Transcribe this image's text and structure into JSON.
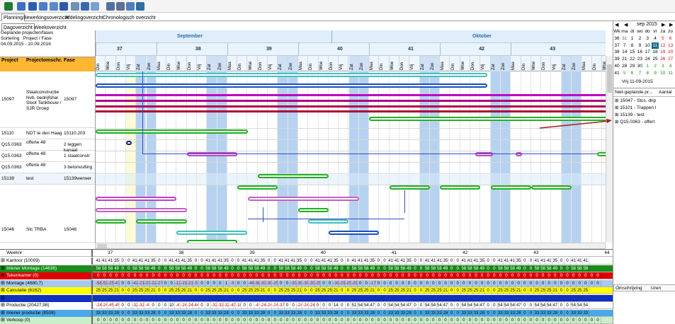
{
  "tabs": [
    "Planning",
    "Bewerkingsoverzicht",
    "Afdelingoverzicht",
    "Chronologisch overzicht"
  ],
  "subtabs": [
    "Dagoverzicht",
    "Weekoverzicht"
  ],
  "info": {
    "line1": "Geplande projecten/fases",
    "line2": "Sortering : Project / Fase",
    "line3": "04.09.2015 - 10.09.2016"
  },
  "columns": {
    "project": "Project",
    "omschr": "Projectomschr.",
    "fase": "Fase"
  },
  "months": [
    {
      "label": "September"
    },
    {
      "label": "Oktober"
    }
  ],
  "weeks": [
    "37",
    "38",
    "39",
    "40",
    "41",
    "42",
    "43"
  ],
  "day_names": [
    "Din",
    "Woe",
    "Don",
    "Vrij",
    "Zat",
    "Zon",
    "Maa"
  ],
  "rows": [
    {
      "project": "15097",
      "omschr": "Staalconstructie Nvb. bedrijfshal Sloot Tankbouw / SJR Groep",
      "fase": "15097"
    },
    {
      "project": "15110",
      "omschr": "NDT te den Haag",
      "fase": "15110.203"
    },
    {
      "project": "Q15.0363",
      "omschr": "offerte 48",
      "fase": "2 leggen kanaal"
    },
    {
      "project": "Q15.0363",
      "omschr": "offerte 48",
      "fase": "1 staalconstr"
    },
    {
      "project": "Q15.0363",
      "omschr": "offerte 48",
      "fase": "3 betonvulling"
    },
    {
      "project": "15139",
      "omschr": "test",
      "fase": "15139werwer"
    },
    {
      "project": "15046",
      "omschr": "Stc TRBA",
      "fase": "15046"
    }
  ],
  "bottom": {
    "weeknr_label": "Weeknr:",
    "week_marks": [
      "37",
      "38",
      "39",
      "40",
      "41",
      "42",
      "43",
      "44"
    ],
    "rows": [
      {
        "label": "Kantoor (10009)",
        "color": "#ffffff",
        "values": [
          "41",
          "41",
          "41",
          "35",
          "0",
          "0",
          "41",
          "41",
          "41",
          "35",
          "0",
          "0",
          "41",
          "41",
          "41",
          "35",
          "0",
          "0",
          "41",
          "41",
          "41",
          "35",
          "0",
          "0",
          "41",
          "41",
          "41",
          "35",
          "0",
          "0",
          "41",
          "41",
          "41",
          "35",
          "0",
          "0",
          "41",
          "41",
          "41",
          "35",
          "0",
          "0",
          "41",
          "41",
          "41",
          "35",
          "0",
          "0",
          "41",
          "41",
          "41",
          "35",
          "0",
          "0",
          "41",
          "41",
          "41",
          "35",
          "0",
          "0",
          "41",
          "41",
          "41",
          "35",
          "0",
          "0",
          "41",
          "41",
          "41",
          "35",
          "0",
          "0",
          "41",
          "41",
          "41",
          "35",
          "0",
          "0",
          "41",
          "41",
          "41"
        ]
      },
      {
        "label": "Inlener Montage (14636)",
        "color": "#1a8a1a",
        "values": [
          "58",
          "58",
          "58",
          "49",
          "0",
          "0",
          "58",
          "58",
          "58",
          "49",
          "0",
          "0",
          "58",
          "58",
          "58",
          "49",
          "0",
          "0",
          "58",
          "58",
          "58",
          "49",
          "0",
          "0",
          "58",
          "58",
          "58",
          "49",
          "0",
          "0",
          "58",
          "58",
          "58",
          "49",
          "0",
          "0",
          "58",
          "58",
          "58",
          "49",
          "0",
          "0",
          "58",
          "58",
          "58",
          "49",
          "0",
          "0",
          "58",
          "58",
          "58",
          "49",
          "0",
          "0",
          "58",
          "58",
          "58",
          "49",
          "0",
          "0",
          "58",
          "58",
          "58",
          "49",
          "0",
          "0",
          "58",
          "58",
          "58",
          "49",
          "0",
          "0",
          "58",
          "58",
          "58",
          "49",
          "0",
          "0",
          "58",
          "58",
          "58"
        ]
      },
      {
        "label": "Tekenkamer (0)",
        "color": "#e00000",
        "values": [
          "0",
          "0",
          "0",
          "0",
          "0",
          "0",
          "0",
          "0",
          "0",
          "0",
          "0",
          "0",
          "0",
          "0",
          "0",
          "0",
          "0",
          "0",
          "0",
          "0",
          "0",
          "0",
          "0",
          "0",
          "0",
          "0",
          "0",
          "0",
          "0",
          "0",
          "0",
          "0",
          "0",
          "0",
          "0",
          "0",
          "0",
          "0",
          "0",
          "0",
          "0",
          "0",
          "0",
          "0",
          "0",
          "0",
          "0",
          "0",
          "0",
          "0",
          "0",
          "0",
          "0",
          "0",
          "0",
          "0",
          "0",
          "0",
          "0",
          "0",
          "0",
          "0",
          "0",
          "0",
          "0",
          "0",
          "0",
          "0",
          "0",
          "0",
          "0",
          "0",
          "0",
          "0",
          "0",
          "0",
          "0",
          "0",
          "0",
          "0",
          "0",
          "0",
          "0"
        ]
      },
      {
        "label": "Montage (4680,7)",
        "color": "#a8c8ee",
        "values": [
          "-58",
          "-53",
          "-25",
          "-47",
          "0",
          "0",
          "-42",
          "-21",
          "-21",
          "-22",
          "-27",
          "0",
          "0",
          "-12",
          "-21",
          "-21",
          "-5",
          "0",
          "0",
          "0",
          "0",
          "1",
          "-5",
          "0",
          "0",
          "-46",
          "-38",
          "-30",
          "-30",
          "-25",
          "0",
          "0",
          "-30",
          "-30",
          "-30",
          "-30",
          "-25",
          "0",
          "0",
          "-39",
          "-29",
          "-25",
          "-29",
          "0",
          "0",
          "-17",
          "0",
          "0",
          "0",
          "0",
          "0",
          "0",
          "0",
          "0",
          "0",
          "0",
          "0",
          "0",
          "0",
          "0",
          "0",
          "0",
          "0",
          "0",
          "0",
          "0",
          "0",
          "0",
          "0",
          "0",
          "0",
          "0",
          "0",
          "0",
          "0",
          "0",
          "0",
          "0",
          "0",
          "0",
          "0",
          "0",
          "0"
        ]
      },
      {
        "label": "Calculatie (6162)",
        "color": "#ffff00",
        "values": [
          "25",
          "25",
          "25",
          "21",
          "0",
          "0",
          "25",
          "25",
          "25",
          "21",
          "0",
          "0",
          "25",
          "25",
          "25",
          "21",
          "0",
          "0",
          "25",
          "25",
          "25",
          "21",
          "0",
          "0",
          "25",
          "25",
          "25",
          "21",
          "0",
          "0",
          "25",
          "25",
          "25",
          "21",
          "0",
          "0",
          "25",
          "25",
          "25",
          "21",
          "0",
          "0",
          "25",
          "25",
          "25",
          "21",
          "0",
          "0",
          "25",
          "25",
          "25",
          "21",
          "0",
          "0",
          "25",
          "25",
          "25",
          "21",
          "0",
          "0",
          "25",
          "25",
          "25",
          "21",
          "0",
          "0",
          "25",
          "25",
          "25",
          "21",
          "0",
          "0",
          "25",
          "25",
          "25",
          "21",
          "0",
          "0",
          "25",
          "25",
          "25"
        ]
      },
      {
        "label": "",
        "color": "#1030c0",
        "values": []
      },
      {
        "label": "Productie (20427,98)",
        "color": "#ffffff",
        "values": [
          "-24",
          "-24",
          "-45",
          "-45",
          "0",
          "0",
          "-32",
          "-32",
          "-4",
          "0",
          "0",
          "0",
          "10",
          "-4",
          "-24",
          "-24",
          "-44",
          "0",
          "0",
          "-32",
          "-32",
          "-32",
          "-40",
          "-18",
          "0",
          "0",
          "-4",
          "-24",
          "-24",
          "-24",
          "-37",
          "0",
          "0",
          "-24",
          "-24",
          "-24",
          "0",
          "0",
          "0",
          "14",
          "0",
          "0",
          "51",
          "54",
          "54",
          "47",
          "0",
          "0",
          "54",
          "54",
          "54",
          "47",
          "0",
          "0",
          "54",
          "54",
          "54",
          "47",
          "0",
          "0",
          "54",
          "54",
          "54",
          "47",
          "0",
          "0",
          "54",
          "54",
          "54",
          "47",
          "0",
          "0",
          "54",
          "54",
          "54",
          "47",
          "0",
          "0",
          "54",
          "54",
          "54"
        ]
      },
      {
        "label": "Inlener productie (8508)",
        "color": "#4aa8e8",
        "values": [
          "33",
          "33",
          "33",
          "28",
          "0",
          "0",
          "33",
          "33",
          "33",
          "28",
          "0",
          "0",
          "33",
          "33",
          "33",
          "28",
          "0",
          "0",
          "33",
          "33",
          "33",
          "28",
          "0",
          "0",
          "33",
          "33",
          "33",
          "28",
          "0",
          "0",
          "33",
          "33",
          "33",
          "28",
          "0",
          "0",
          "33",
          "33",
          "33",
          "28",
          "0",
          "0",
          "33",
          "33",
          "33",
          "28",
          "0",
          "0",
          "33",
          "33",
          "33",
          "28",
          "0",
          "0",
          "33",
          "33",
          "33",
          "28",
          "0",
          "0",
          "33",
          "33",
          "33",
          "28",
          "0",
          "0",
          "33",
          "33",
          "33",
          "28",
          "0",
          "0",
          "33",
          "33",
          "33",
          "28",
          "0",
          "0",
          "33",
          "33",
          "33"
        ]
      },
      {
        "label": "Verkoop (0)",
        "color": "#c8f0c8",
        "values": [
          "0",
          "0",
          "0",
          "0",
          "0",
          "0",
          "0",
          "0",
          "0",
          "0",
          "0",
          "0",
          "0",
          "0",
          "0",
          "0",
          "0",
          "0",
          "0",
          "0",
          "0",
          "0",
          "0",
          "0",
          "0",
          "0",
          "0",
          "0",
          "0",
          "0",
          "0",
          "0",
          "0",
          "0",
          "0",
          "0",
          "0",
          "0",
          "0",
          "0",
          "0",
          "0",
          "0",
          "0",
          "0",
          "0",
          "0",
          "0",
          "0",
          "0",
          "0",
          "0",
          "0",
          "0",
          "0",
          "0",
          "0",
          "0",
          "0",
          "0",
          "0",
          "0",
          "0",
          "0",
          "0",
          "0",
          "0",
          "0",
          "0",
          "0",
          "0",
          "0",
          "0",
          "0",
          "0",
          "0",
          "0",
          "0",
          "0",
          "0",
          "0",
          "0",
          "0"
        ]
      }
    ]
  },
  "calendar": {
    "title": "sep 2015",
    "header": [
      "Wk",
      "ma",
      "di",
      "wo",
      "do",
      "vr",
      "za",
      "zo"
    ],
    "weeks": [
      [
        "36",
        "31",
        "1",
        "2",
        "3",
        "4",
        "5",
        "6"
      ],
      [
        "37",
        "7",
        "8",
        "9",
        "10",
        "11",
        "12",
        "13"
      ],
      [
        "38",
        "14",
        "15",
        "16",
        "17",
        "18",
        "19",
        "20"
      ],
      [
        "39",
        "21",
        "22",
        "23",
        "24",
        "25",
        "26",
        "27"
      ],
      [
        "40",
        "28",
        "29",
        "30",
        "1",
        "2",
        "3",
        "4"
      ],
      [
        "41",
        "5",
        "6",
        "7",
        "8",
        "9",
        "10",
        "11"
      ]
    ],
    "today": "Vrij 11-09-2015"
  },
  "not_planned": {
    "header": "Niet-geplande pr...",
    "count_header": "Aantal",
    "items": [
      "15047 - Stcs. drip",
      "15101 - Trappen l",
      "15139 - test",
      "Q15.0363 - offert"
    ]
  },
  "bottom_right": {
    "col1": "Omschrijving",
    "col2": "Uren"
  }
}
